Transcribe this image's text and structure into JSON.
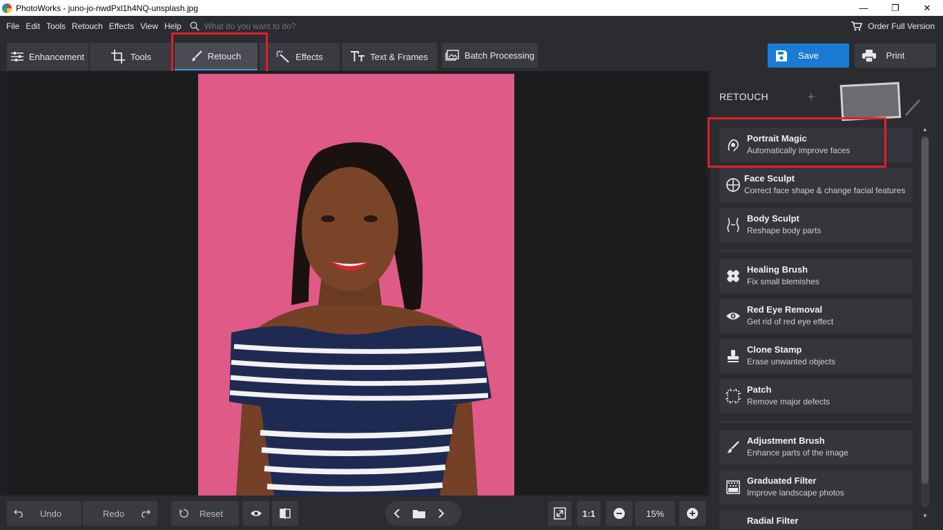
{
  "window": {
    "title": "PhotoWorks - juno-jo-nwdPxl1h4NQ-unsplash.jpg",
    "minimize": "—",
    "maximize": "❐",
    "close": "✕"
  },
  "menu": {
    "file": "File",
    "edit": "Edit",
    "tools": "Tools",
    "retouch": "Retouch",
    "effects": "Effects",
    "view": "View",
    "help": "Help",
    "search_placeholder": "What do you want to do?",
    "order": "Order Full Version"
  },
  "tabs": {
    "enhancement": "Enhancement",
    "tools": "Tools",
    "retouch": "Retouch",
    "effects": "Effects",
    "text_frames": "Text & Frames",
    "batch": "Batch Processing"
  },
  "actions": {
    "save": "Save",
    "print": "Print"
  },
  "panel": {
    "title": "RETOUCH",
    "tools": [
      {
        "name": "Portrait Magic",
        "desc": "Automatically improve faces",
        "icon": "portrait-magic-icon"
      },
      {
        "name": "Face Sculpt",
        "desc": "Correct face shape & change facial features",
        "icon": "face-sculpt-icon"
      },
      {
        "name": "Body Sculpt",
        "desc": "Reshape body parts",
        "icon": "body-sculpt-icon"
      },
      {
        "name": "Healing Brush",
        "desc": "Fix small blemishes",
        "icon": "healing-brush-icon"
      },
      {
        "name": "Red Eye Removal",
        "desc": "Get rid of red eye effect",
        "icon": "eye-icon"
      },
      {
        "name": "Clone Stamp",
        "desc": "Erase unwanted objects",
        "icon": "stamp-icon"
      },
      {
        "name": "Patch",
        "desc": "Remove major defects",
        "icon": "patch-icon"
      },
      {
        "name": "Adjustment Brush",
        "desc": "Enhance parts of the image",
        "icon": "brush-icon"
      },
      {
        "name": "Graduated Filter",
        "desc": "Improve landscape photos",
        "icon": "graduated-filter-icon"
      },
      {
        "name": "Radial Filter",
        "desc": "",
        "icon": "radial-filter-icon"
      }
    ]
  },
  "bottom": {
    "undo": "Undo",
    "redo": "Redo",
    "reset": "Reset",
    "fit_ratio": "1:1",
    "zoom": "15%"
  },
  "colors": {
    "accent": "#1a7ad4",
    "highlight": "#e0202a",
    "photo_background": "#e05a87"
  }
}
